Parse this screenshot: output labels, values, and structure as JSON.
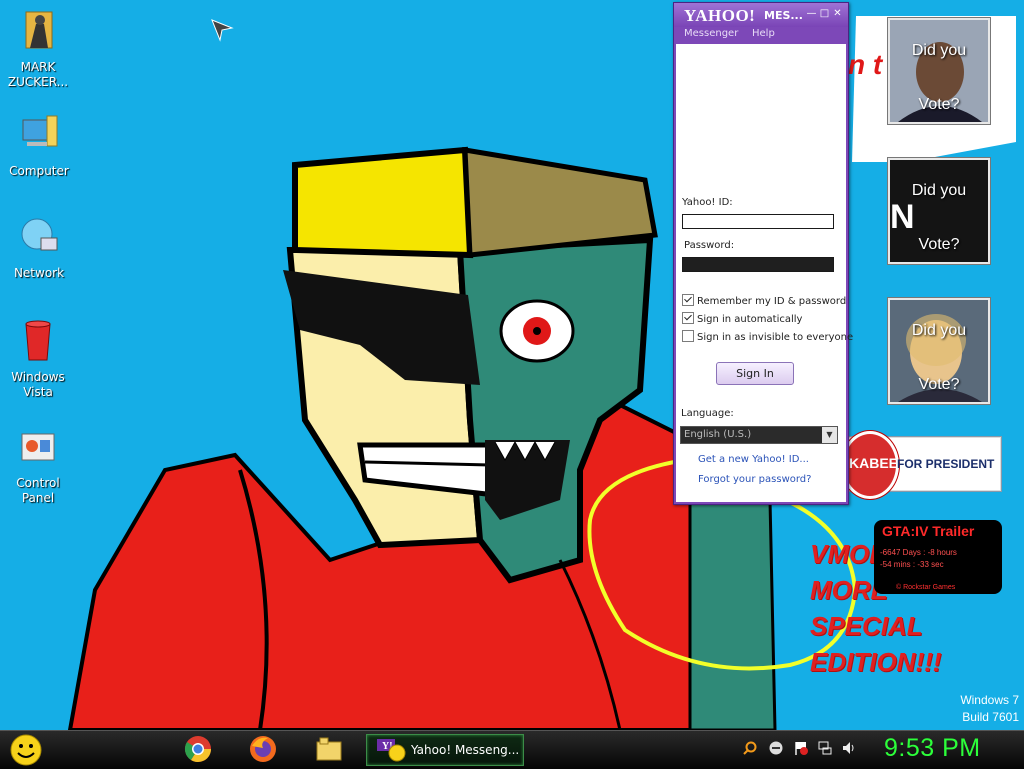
{
  "desktop": {
    "icons": [
      {
        "label": "MARK ZUCKER...",
        "icon": "user-folder-icon"
      },
      {
        "label": "Computer",
        "icon": "computer-icon"
      },
      {
        "label": "Network",
        "icon": "network-globe-icon"
      },
      {
        "label": "Windows Vista",
        "icon": "recycle-bin-icon"
      },
      {
        "label": "Control Panel",
        "icon": "control-panel-icon"
      }
    ],
    "widgets": {
      "vote_obama": {
        "line1": "Did you",
        "line2": "Vote?"
      },
      "vote_n": {
        "line1": "Did you",
        "line2": "Vote?",
        "logo": "N"
      },
      "vote_clinton": {
        "line1": "Did you",
        "line2": "Vote?"
      },
      "huckabee": {
        "name": "KABEE",
        "tagline": "FOR PRESIDENT"
      },
      "gta": {
        "title": "GTA:IV Trailer",
        "line1": "-6647 Days : -8 hours",
        "line2": "-54 mins : -33 sec",
        "credit": "© Rockstar Games"
      }
    },
    "wallpaper_text": {
      "vmod": [
        "VMOD",
        "MORE",
        "SPECIAL",
        "EDITION!!!"
      ]
    },
    "watermark": {
      "line1": "Windows 7",
      "line2": "Build 7601"
    }
  },
  "messenger": {
    "logo": "YAHOO!",
    "title": "MES...",
    "menu": [
      "Messenger",
      "Help"
    ],
    "yahoo_id_label": "Yahoo! ID:",
    "yahoo_id_value": "",
    "password_label": "Password:",
    "remember_label": "Remember my ID & password",
    "remember_checked": true,
    "auto_label": "Sign in automatically",
    "auto_checked": true,
    "invisible_label": "Sign in as invisible to everyone",
    "invisible_checked": false,
    "signin_label": "Sign In",
    "language_label": "Language:",
    "language_value": "English (U.S.)",
    "link_new_id": "Get a new Yahoo! ID...",
    "link_forgot": "Forgot your password?",
    "colors": {
      "frame": "#7d48b8",
      "link": "#2b53b8"
    }
  },
  "taskbar": {
    "start": "smiley-start-orb",
    "pinned": [
      "chrome-icon",
      "firefox-icon",
      "windows-explorer-icon"
    ],
    "active_task": {
      "label": "Yahoo! Messeng...",
      "icon": "yahoo-messenger-icon"
    },
    "tray": [
      "search-icon",
      "status-icon",
      "action-center-flag-icon",
      "network-icon",
      "volume-icon"
    ],
    "clock": "9:53 PM",
    "clock_color": "#2cff3a"
  }
}
